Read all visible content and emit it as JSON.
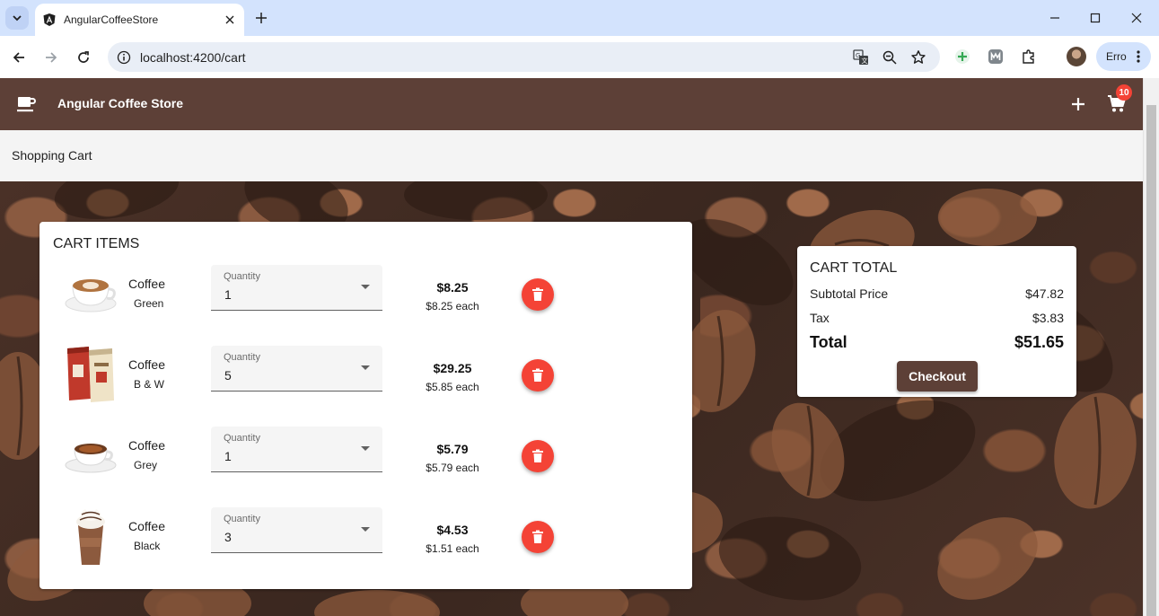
{
  "browser": {
    "tab_title": "AngularCoffeeStore",
    "url": "localhost:4200/cart",
    "profile_label": "Erro",
    "icons": [
      "tab-search-icon",
      "angular-favicon",
      "close-icon",
      "plus-icon",
      "minimize-icon",
      "maximize-icon",
      "close-window-icon",
      "back-icon",
      "forward-icon",
      "reload-icon",
      "info-icon",
      "translate-icon",
      "zoom-icon",
      "star-icon",
      "extension-plus-icon",
      "extension-m-icon",
      "puzzle-icon",
      "more-vert-icon"
    ]
  },
  "app": {
    "title": "Angular Coffee Store",
    "cart_badge": "10",
    "page_title": "Shopping Cart",
    "colors": {
      "primary": "#5d4037",
      "accent": "#f44336",
      "field_bg": "#f5f5f5"
    }
  },
  "cart": {
    "title": "CART ITEMS",
    "quantity_label": "Quantity",
    "items": [
      {
        "name": "Coffee",
        "variant": "Green",
        "quantity": "1",
        "total": "$8.25",
        "each": "$8.25 each",
        "image": "latte-cup"
      },
      {
        "name": "Coffee",
        "variant": "B & W",
        "quantity": "5",
        "total": "$29.25",
        "each": "$5.85 each",
        "image": "coffee-bags"
      },
      {
        "name": "Coffee",
        "variant": "Grey",
        "quantity": "1",
        "total": "$5.79",
        "each": "$5.79 each",
        "image": "espresso-cup"
      },
      {
        "name": "Coffee",
        "variant": "Black",
        "quantity": "3",
        "total": "$4.53",
        "each": "$1.51 each",
        "image": "frappe-cup"
      }
    ]
  },
  "summary": {
    "title": "CART TOTAL",
    "subtotal_label": "Subtotal Price",
    "subtotal_value": "$47.82",
    "tax_label": "Tax",
    "tax_value": "$3.83",
    "total_label": "Total",
    "total_value": "$51.65",
    "checkout_label": "Checkout"
  }
}
